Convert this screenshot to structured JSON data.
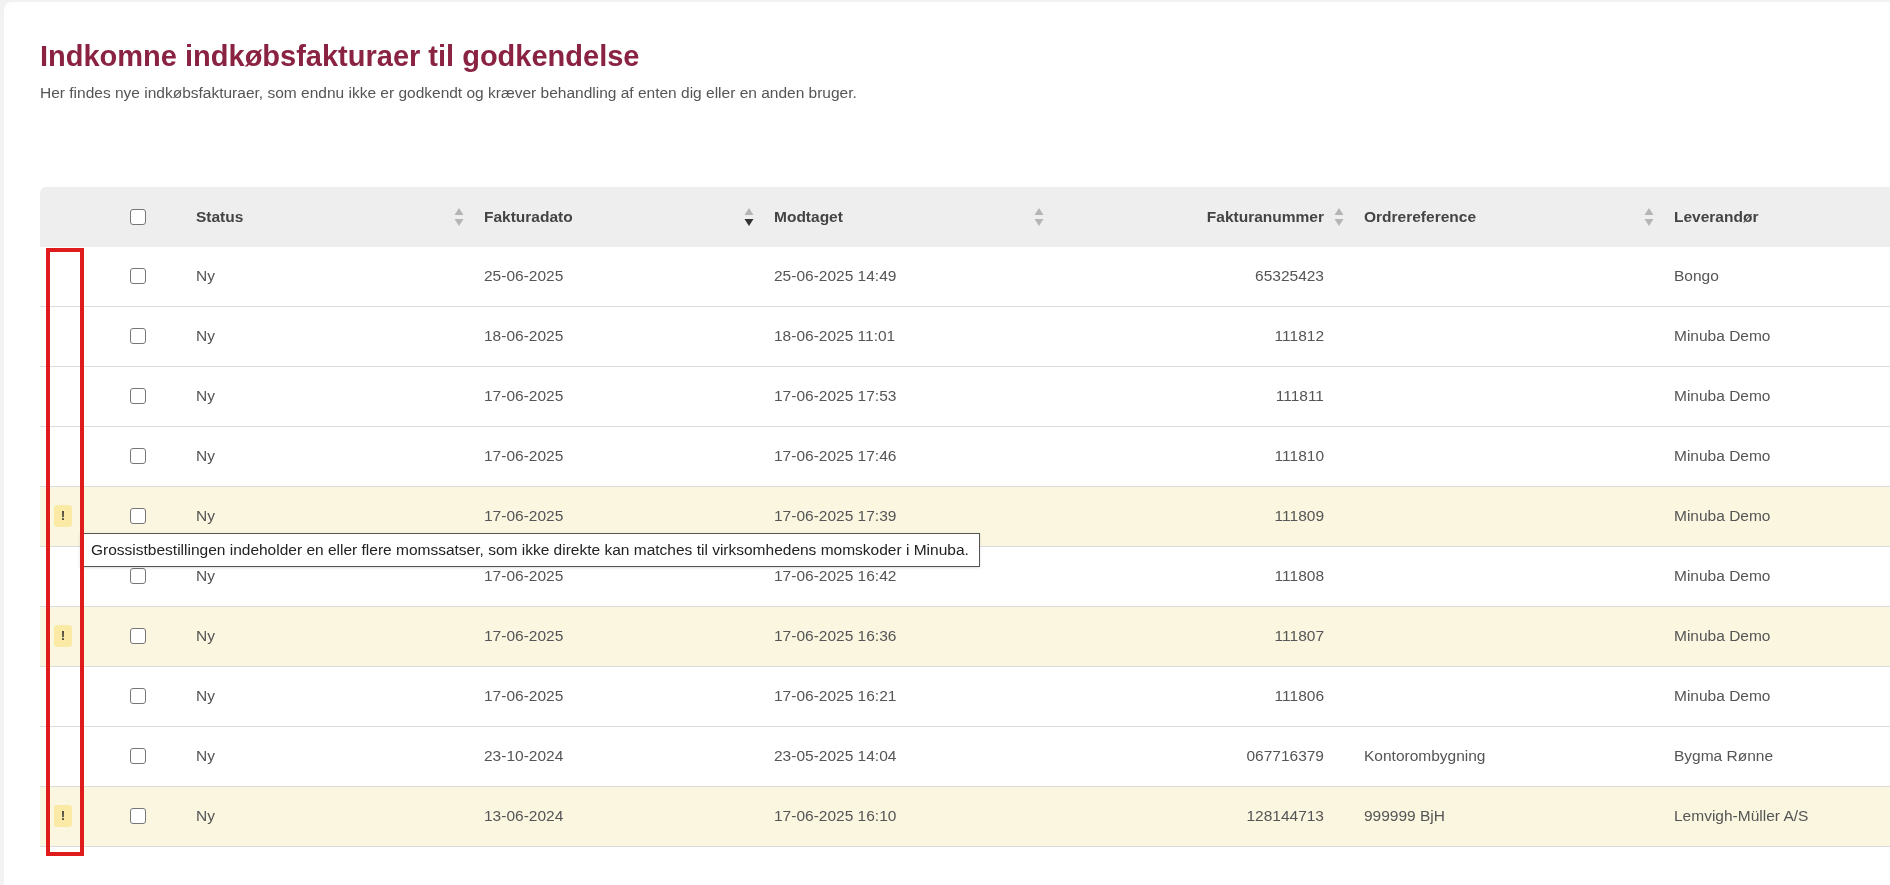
{
  "page": {
    "title": "Indkomne indkøbsfakturaer til godkendelse",
    "subtitle": "Her findes nye indkøbsfakturaer, som endnu ikke er godkendt og kræver behandling af enten dig eller en anden bruger."
  },
  "table": {
    "select_all": {
      "checked": false
    },
    "columns": [
      {
        "label": "Status",
        "sorted": false
      },
      {
        "label": "Fakturadato",
        "sorted": true
      },
      {
        "label": "Modtaget",
        "sorted": false
      },
      {
        "label": "Fakturanummer",
        "sorted": false
      },
      {
        "label": "Ordrereference",
        "sorted": false
      },
      {
        "label": "Leverandør"
      }
    ],
    "rows": [
      {
        "warning": false,
        "checked": false,
        "cells": [
          "Ny",
          "25-06-2025",
          "25-06-2025 14:49",
          "65325423",
          "",
          "Bongo"
        ]
      },
      {
        "warning": false,
        "checked": false,
        "cells": [
          "Ny",
          "18-06-2025",
          "18-06-2025 11:01",
          "111812",
          "",
          "Minuba Demo"
        ]
      },
      {
        "warning": false,
        "checked": false,
        "cells": [
          "Ny",
          "17-06-2025",
          "17-06-2025 17:53",
          "111811",
          "",
          "Minuba Demo"
        ]
      },
      {
        "warning": false,
        "checked": false,
        "cells": [
          "Ny",
          "17-06-2025",
          "17-06-2025 17:46",
          "111810",
          "",
          "Minuba Demo"
        ]
      },
      {
        "warning": true,
        "warning_mark": "!",
        "checked": false,
        "cells": [
          "Ny",
          "17-06-2025",
          "17-06-2025 17:39",
          "111809",
          "",
          "Minuba Demo"
        ]
      },
      {
        "warning": false,
        "checked": false,
        "cells": [
          "Ny",
          "17-06-2025",
          "17-06-2025 16:42",
          "111808",
          "",
          "Minuba Demo"
        ]
      },
      {
        "warning": true,
        "warning_mark": "!",
        "checked": false,
        "cells": [
          "Ny",
          "17-06-2025",
          "17-06-2025 16:36",
          "111807",
          "",
          "Minuba Demo"
        ]
      },
      {
        "warning": false,
        "checked": false,
        "cells": [
          "Ny",
          "17-06-2025",
          "17-06-2025 16:21",
          "111806",
          "",
          "Minuba Demo"
        ]
      },
      {
        "warning": false,
        "checked": false,
        "cells": [
          "Ny",
          "23-10-2024",
          "23-05-2025 14:04",
          "067716379",
          "Kontorombygning",
          "Bygma Rønne"
        ]
      },
      {
        "warning": true,
        "warning_mark": "!",
        "checked": false,
        "cells": [
          "Ny",
          "13-06-2024",
          "17-06-2025 16:10",
          "128144713",
          "999999 BjH",
          "Lemvigh-Müller A/S"
        ]
      }
    ]
  },
  "tooltip": {
    "text": "Grossistbestillingen indeholder en eller flere momssatser, som ikke direkte kan matches til virksomhedens momskoder i Minuba."
  },
  "highlight_frame": {
    "shown": true
  }
}
